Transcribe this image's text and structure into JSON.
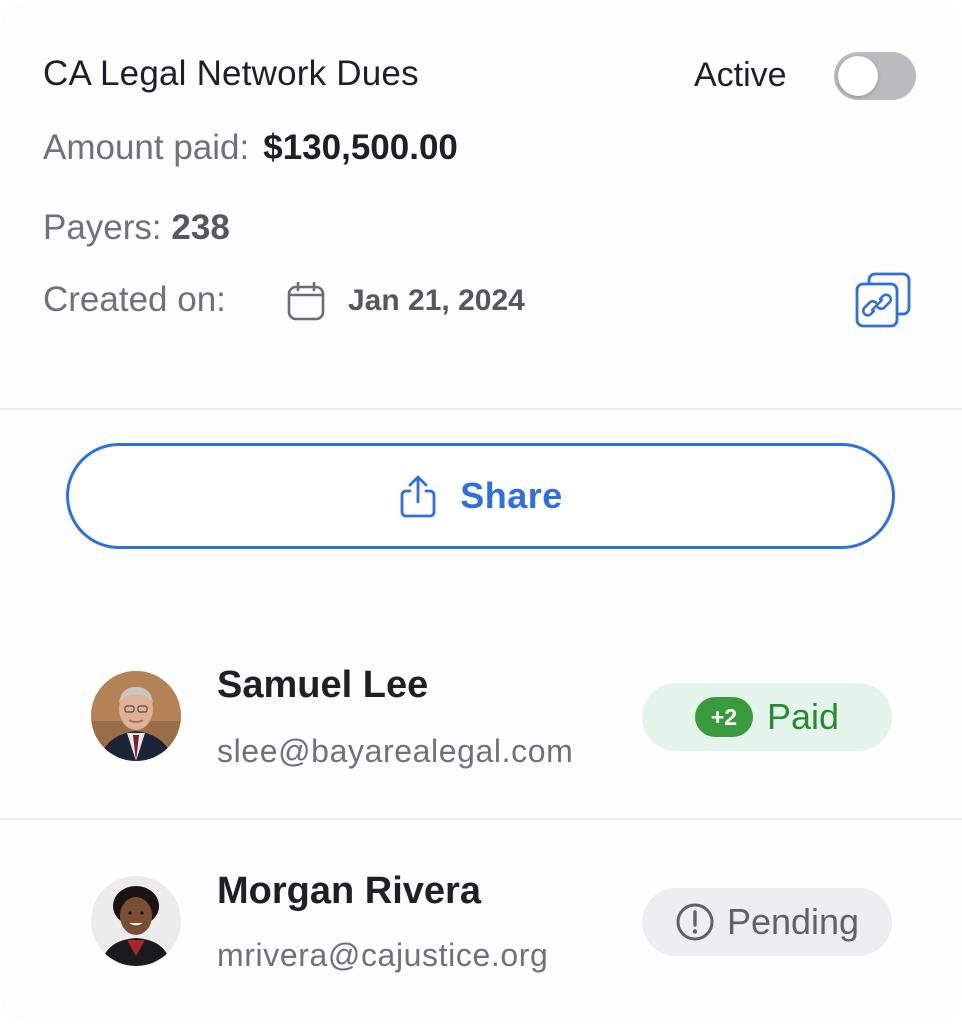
{
  "campaign": {
    "title": "CA Legal Network Dues",
    "status_label": "Active",
    "toggle_on": false,
    "amount_label": "Amount paid:",
    "amount_value": "$130,500.00",
    "payers_label": "Payers:",
    "payers_value": "238",
    "created_label": "Created on:",
    "created_date": "Jan 21, 2024"
  },
  "share_button": {
    "label": "Share"
  },
  "payers": [
    {
      "name": "Samuel Lee",
      "email": "slee@bayarealegal.com",
      "count_badge": "+2",
      "status": "Paid"
    },
    {
      "name": "Morgan Rivera",
      "email": "mrivera@cajustice.org",
      "status": "Pending"
    }
  ],
  "colors": {
    "accent": "#2f6fe0",
    "paid_green": "#3a9a3e",
    "paid_bg": "#e4f4ea",
    "pending_bg": "#eceef0",
    "toggle_off": "#b9bbbf"
  },
  "icons": [
    "calendar-icon",
    "copy-link-icon",
    "share-icon",
    "alert-circle-icon"
  ]
}
